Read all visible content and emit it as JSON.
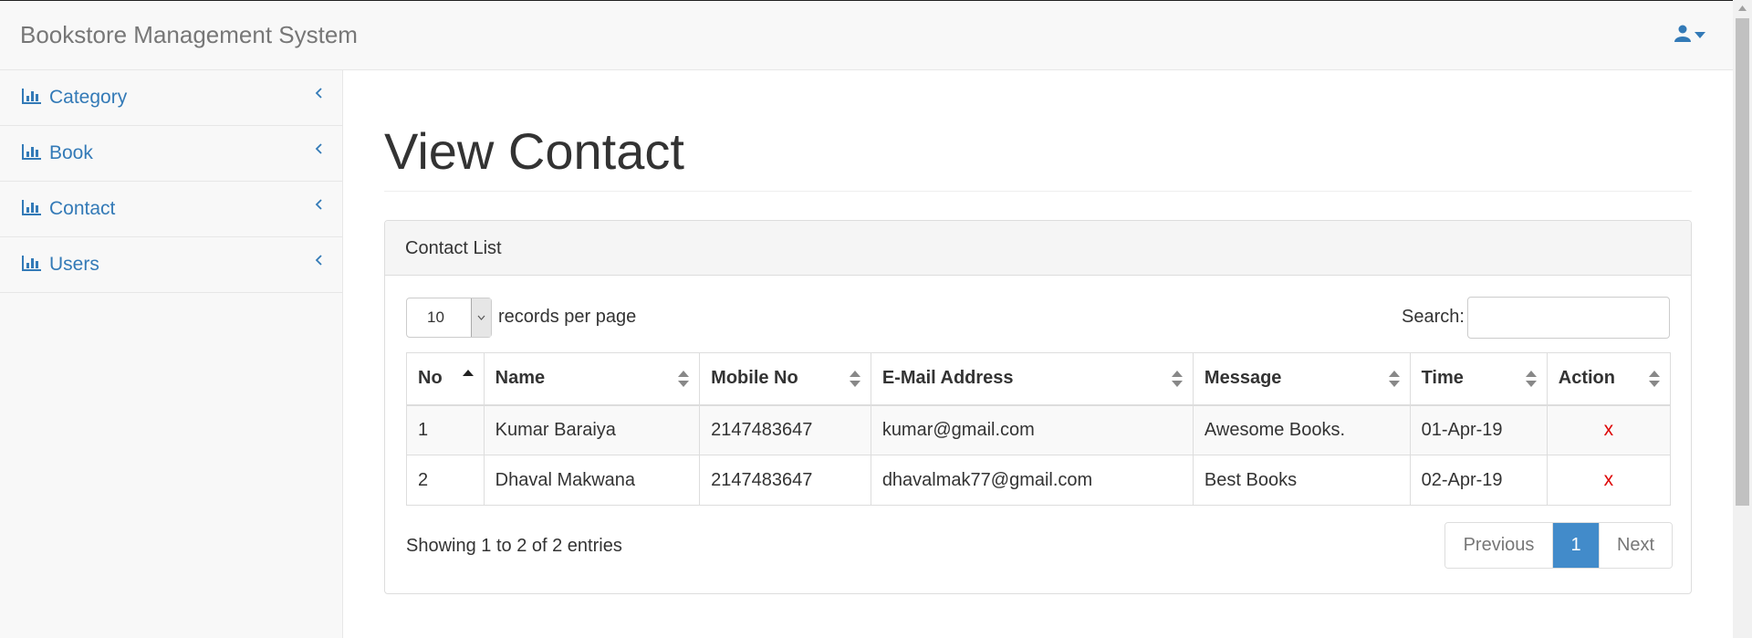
{
  "app": {
    "title": "Bookstore Management System"
  },
  "header": {
    "user_icon": "user-icon",
    "caret_icon": "caret-down-icon"
  },
  "sidebar": {
    "items": [
      {
        "label": "Category",
        "icon": "bar-chart-icon"
      },
      {
        "label": "Book",
        "icon": "bar-chart-icon"
      },
      {
        "label": "Contact",
        "icon": "bar-chart-icon"
      },
      {
        "label": "Users",
        "icon": "bar-chart-icon"
      }
    ]
  },
  "main": {
    "page_title": "View Contact",
    "panel_title": "Contact List",
    "length": {
      "value": "10",
      "label": "records per page"
    },
    "search": {
      "label": "Search:",
      "value": "",
      "placeholder": ""
    },
    "table": {
      "columns": [
        "No",
        "Name",
        "Mobile No",
        "E-Mail Address",
        "Message",
        "Time",
        "Action"
      ],
      "sorted_column": "No",
      "rows": [
        {
          "no": "1",
          "name": "Kumar Baraiya",
          "mobile": "2147483647",
          "email": "kumar@gmail.com",
          "message": "Awesome Books.",
          "time": "01-Apr-19",
          "action": "x"
        },
        {
          "no": "2",
          "name": "Dhaval Makwana",
          "mobile": "2147483647",
          "email": "dhavalmak77@gmail.com",
          "message": "Best Books",
          "time": "02-Apr-19",
          "action": "x"
        }
      ]
    },
    "info": "Showing 1 to 2 of 2 entries",
    "pagination": {
      "previous": "Previous",
      "current": "1",
      "next": "Next"
    }
  },
  "colors": {
    "link": "#337ab7",
    "active_page": "#428bca",
    "delete": "#dd0000",
    "header_bg": "#f8f8f8"
  }
}
